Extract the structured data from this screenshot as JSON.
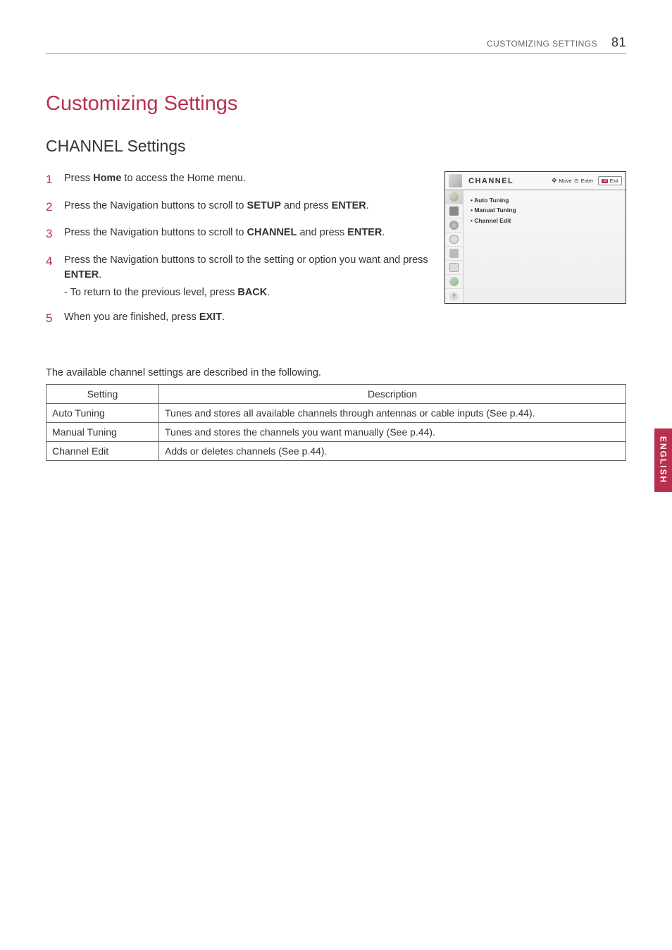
{
  "header": {
    "breadcrumb": "CUSTOMIZING SETTINGS",
    "page_number": "81"
  },
  "main_title": "Customizing Settings",
  "section_title": "CHANNEL Settings",
  "steps": [
    {
      "num": "1",
      "pre": "Press ",
      "bold1": "Home",
      "post": " to access the Home menu."
    },
    {
      "num": "2",
      "pre": "Press the Navigation buttons to scroll to ",
      "bold1": "SETUP",
      "mid": " and press ",
      "bold2": "ENTER",
      "post": "."
    },
    {
      "num": "3",
      "pre": "Press the Navigation buttons to scroll to ",
      "bold1": "CHANNEL",
      "mid": " and press ",
      "bold2": "ENTER",
      "post": "."
    },
    {
      "num": "4",
      "pre": "Press the Navigation buttons to scroll to the setting or option you want and press ",
      "bold1": "ENTER",
      "post": ".",
      "sub_pre": "- To return to the previous level, press ",
      "sub_bold": "BACK",
      "sub_post": "."
    },
    {
      "num": "5",
      "pre": "When you are finished, press ",
      "bold1": "EXIT",
      "post": "."
    }
  ],
  "osd": {
    "title": "CHANNEL",
    "move_label": "Move",
    "enter_label": "Enter",
    "exit_label": "Exit",
    "items": [
      "Auto Tuning",
      "Manual Tuning",
      "Channel Edit"
    ]
  },
  "intro": "The available channel settings are described in the following.",
  "table": {
    "headers": {
      "setting": "Setting",
      "description": "Description"
    },
    "rows": [
      {
        "name": "Auto Tuning",
        "desc": "Tunes and stores all available channels through antennas or cable inputs  (See p.44)."
      },
      {
        "name": "Manual Tuning",
        "desc": "Tunes and stores the channels you want manually (See p.44)."
      },
      {
        "name": "Channel Edit",
        "desc": "Adds or deletes channels (See p.44)."
      }
    ]
  },
  "side_tab": "ENGLISH"
}
